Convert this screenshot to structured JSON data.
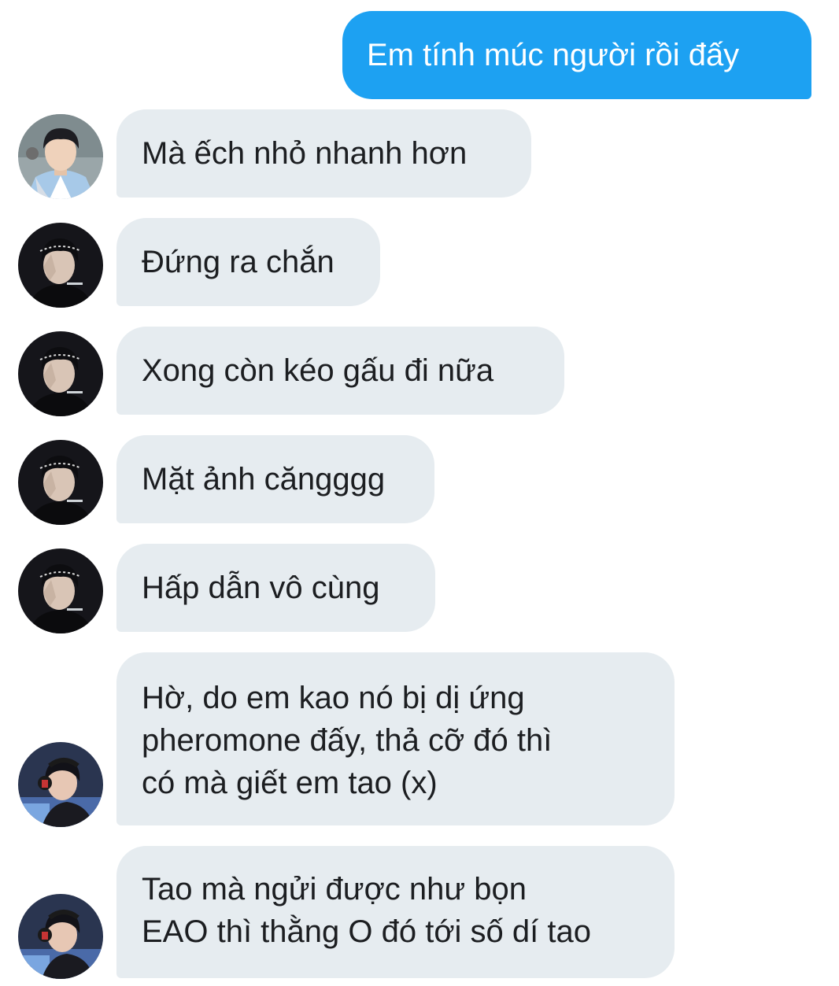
{
  "conversation": {
    "outgoing": [
      {
        "text": "Em tính múc người rồi đấy"
      }
    ],
    "incoming": [
      {
        "lines": [
          "Mà ếch nhỏ nhanh hơn"
        ],
        "avatar": "avatar-hanbok"
      },
      {
        "lines": [
          "Đứng ra chắn"
        ],
        "avatar": "avatar-dark"
      },
      {
        "lines": [
          "Xong còn kéo gấu đi nữa"
        ],
        "avatar": "avatar-dark"
      },
      {
        "lines": [
          "Mặt ảnh căngggg"
        ],
        "avatar": "avatar-dark"
      },
      {
        "lines": [
          "Hấp dẫn vô cùng"
        ],
        "avatar": "avatar-dark"
      },
      {
        "lines": [
          "Hờ, do em kao nó bị dị ứng",
          "pheromone đấy, thả cỡ đó thì",
          "có mà giết em tao (x)"
        ],
        "avatar": "avatar-gamer"
      },
      {
        "lines": [
          "Tao mà ngửi được như bọn",
          "EAO thì thằng O đó tới số dí tao"
        ],
        "avatar": "avatar-gamer"
      }
    ]
  },
  "colors": {
    "outgoing_bubble": "#1da1f2",
    "incoming_bubble": "#e6ecf0",
    "incoming_text": "#1c1e21",
    "outgoing_text": "#ffffff"
  }
}
